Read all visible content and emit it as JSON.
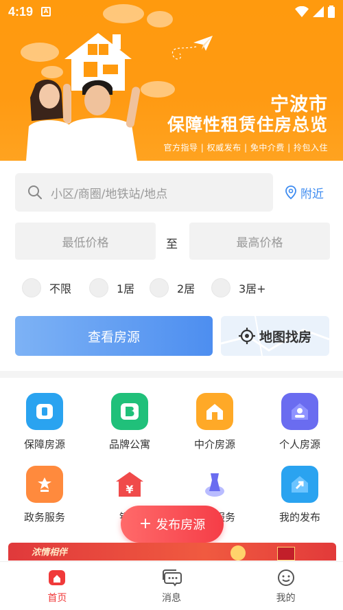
{
  "status_bar": {
    "time": "4:19",
    "notification_icon": "a-letter-icon"
  },
  "banner": {
    "city": "宁波市",
    "title": "保障性租赁住房总览",
    "tagline": "官方指导 | 权威发布 | 免中介费 | 拎包入住"
  },
  "search": {
    "placeholder": "小区/商圈/地铁站/地点",
    "nearby_label": "附近"
  },
  "price": {
    "min_placeholder": "最低价格",
    "to_label": "至",
    "max_placeholder": "最高价格"
  },
  "rooms": [
    {
      "label": "不限"
    },
    {
      "label": "1居"
    },
    {
      "label": "2居"
    },
    {
      "label": "3居+"
    }
  ],
  "actions": {
    "view_listings": "查看房源",
    "map_search": "地图找房"
  },
  "grid": [
    {
      "label": "保障房源",
      "icon": "guarantee-housing-icon",
      "color": "#2aa3f0"
    },
    {
      "label": "品牌公寓",
      "icon": "brand-apartment-icon",
      "color": "#20c07a"
    },
    {
      "label": "中介房源",
      "icon": "agency-housing-icon",
      "color": "#ffa927"
    },
    {
      "label": "个人房源",
      "icon": "personal-housing-icon",
      "color": "#6a6cf0"
    },
    {
      "label": "政务服务",
      "icon": "government-service-icon",
      "color": "#ff8a3d"
    },
    {
      "label": "银行",
      "icon": "bank-icon",
      "color": "#f04a4a"
    },
    {
      "label": "服务",
      "icon": "service-icon",
      "color": "#6a6cf0"
    },
    {
      "label": "我的发布",
      "icon": "my-publish-icon",
      "color": "#2aa3f0"
    }
  ],
  "publish_button": {
    "label": "发布房源"
  },
  "ad": {
    "text": "浓情相伴"
  },
  "tabs": [
    {
      "label": "首页",
      "icon": "home-icon",
      "active": true
    },
    {
      "label": "消息",
      "icon": "message-icon",
      "active": false
    },
    {
      "label": "我的",
      "icon": "profile-icon",
      "active": false
    }
  ],
  "colors": {
    "accent_blue": "#3d8bf0",
    "banner_orange": "#ff9a0e",
    "accent_red": "#f03a3a"
  }
}
